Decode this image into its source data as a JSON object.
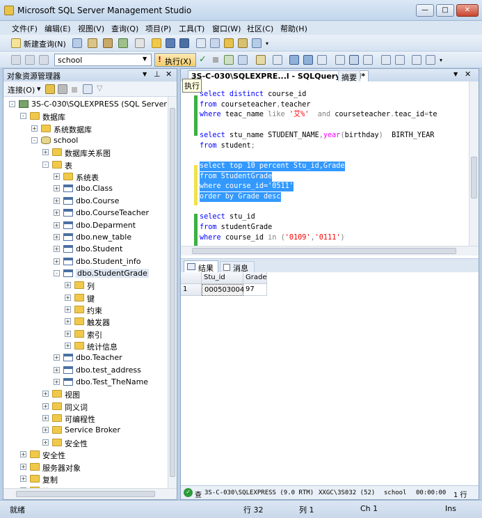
{
  "window": {
    "title": "Microsoft SQL Server Management Studio",
    "minimize": "—",
    "maximize": "□",
    "close": "✕"
  },
  "menu": [
    "文件(F)",
    "编辑(E)",
    "视图(V)",
    "查询(Q)",
    "项目(P)",
    "工具(T)",
    "窗口(W)",
    "社区(C)",
    "帮助(H)"
  ],
  "toolbar1": {
    "new_query": "新建查询(N)"
  },
  "toolbar2": {
    "database": "school",
    "execute": "执行(X)"
  },
  "object_explorer": {
    "title": "对象资源管理器",
    "connect": "连接(O)",
    "tree": [
      {
        "label": "3S-C-030\\SQLEXPRESS (SQL Server 9.0",
        "level": 0,
        "exp": "-",
        "icon": "server"
      },
      {
        "label": "数据库",
        "level": 1,
        "exp": "-",
        "icon": "folder"
      },
      {
        "label": "系统数据库",
        "level": 2,
        "exp": "+",
        "icon": "folder"
      },
      {
        "label": "school",
        "level": 2,
        "exp": "-",
        "icon": "db"
      },
      {
        "label": "数据库关系图",
        "level": 3,
        "exp": "+",
        "icon": "folder"
      },
      {
        "label": "表",
        "level": 3,
        "exp": "-",
        "icon": "folder"
      },
      {
        "label": "系统表",
        "level": 4,
        "exp": "+",
        "icon": "folder"
      },
      {
        "label": "dbo.Class",
        "level": 4,
        "exp": "+",
        "icon": "table"
      },
      {
        "label": "dbo.Course",
        "level": 4,
        "exp": "+",
        "icon": "table"
      },
      {
        "label": "dbo.CourseTeacher",
        "level": 4,
        "exp": "+",
        "icon": "table"
      },
      {
        "label": "dbo.Deparment",
        "level": 4,
        "exp": "+",
        "icon": "table"
      },
      {
        "label": "dbo.new_table",
        "level": 4,
        "exp": "+",
        "icon": "table"
      },
      {
        "label": "dbo.Student",
        "level": 4,
        "exp": "+",
        "icon": "table"
      },
      {
        "label": "dbo.Student_info",
        "level": 4,
        "exp": "+",
        "icon": "table"
      },
      {
        "label": "dbo.StudentGrade",
        "level": 4,
        "exp": "-",
        "icon": "table",
        "selected": true
      },
      {
        "label": "列",
        "level": 5,
        "exp": "+",
        "icon": "folder"
      },
      {
        "label": "键",
        "level": 5,
        "exp": "+",
        "icon": "folder"
      },
      {
        "label": "约束",
        "level": 5,
        "exp": "+",
        "icon": "folder"
      },
      {
        "label": "触发器",
        "level": 5,
        "exp": "+",
        "icon": "folder"
      },
      {
        "label": "索引",
        "level": 5,
        "exp": "+",
        "icon": "folder"
      },
      {
        "label": "统计信息",
        "level": 5,
        "exp": "+",
        "icon": "folder"
      },
      {
        "label": "dbo.Teacher",
        "level": 4,
        "exp": "+",
        "icon": "table"
      },
      {
        "label": "dbo.test_address",
        "level": 4,
        "exp": "+",
        "icon": "table"
      },
      {
        "label": "dbo.Test_TheName",
        "level": 4,
        "exp": "+",
        "icon": "table"
      },
      {
        "label": "视图",
        "level": 3,
        "exp": "+",
        "icon": "folder"
      },
      {
        "label": "同义词",
        "level": 3,
        "exp": "+",
        "icon": "folder"
      },
      {
        "label": "可编程性",
        "level": 3,
        "exp": "+",
        "icon": "folder"
      },
      {
        "label": "Service Broker",
        "level": 3,
        "exp": "+",
        "icon": "folder"
      },
      {
        "label": "安全性",
        "level": 3,
        "exp": "+",
        "icon": "folder"
      },
      {
        "label": "安全性",
        "level": 1,
        "exp": "+",
        "icon": "folder"
      },
      {
        "label": "服务器对象",
        "level": 1,
        "exp": "+",
        "icon": "folder"
      },
      {
        "label": "复制",
        "level": 1,
        "exp": "+",
        "icon": "folder"
      },
      {
        "label": "管理",
        "level": 1,
        "exp": "+",
        "icon": "folder"
      }
    ]
  },
  "editor": {
    "tab_active": "3S-C-030\\SQLEXPRE...l - SQLQuery1.sql*",
    "tab_summary": "摘要",
    "tooltip": "执行",
    "code": [
      {
        "segs": [
          [
            "kw",
            "select distinct "
          ],
          [
            "",
            "course_id"
          ]
        ]
      },
      {
        "segs": [
          [
            "kw",
            "from "
          ],
          [
            "",
            "courseteacher"
          ],
          [
            "op",
            ","
          ],
          [
            "",
            "teacher"
          ]
        ]
      },
      {
        "segs": [
          [
            "kw",
            "where "
          ],
          [
            "",
            "teac_name "
          ],
          [
            "op",
            "like "
          ],
          [
            "str",
            "'艾%'"
          ],
          [
            "",
            "  "
          ],
          [
            "op",
            "and "
          ],
          [
            "",
            "courseteacher"
          ],
          [
            "op",
            "."
          ],
          [
            "",
            "teac_id"
          ],
          [
            "op",
            "="
          ],
          [
            "",
            "te"
          ]
        ]
      },
      {
        "segs": []
      },
      {
        "segs": [
          [
            "kw",
            "select "
          ],
          [
            "",
            "stu_name STUDENT_NAME"
          ],
          [
            "op",
            ","
          ],
          [
            "fn",
            "year"
          ],
          [
            "op",
            "("
          ],
          [
            "",
            "birthday"
          ],
          [
            "op",
            ")"
          ],
          [
            "",
            "  BIRTH_YEAR"
          ]
        ]
      },
      {
        "segs": [
          [
            "kw",
            "from "
          ],
          [
            "",
            "student"
          ],
          [
            "op",
            ";"
          ]
        ]
      },
      {
        "segs": []
      },
      {
        "hl": true,
        "segs": [
          [
            "kw",
            "select top 10 percent Stu_id,Grade"
          ]
        ]
      },
      {
        "hl": true,
        "segs": [
          [
            "kw",
            "from StudentGrade"
          ]
        ]
      },
      {
        "hl": true,
        "segs": [
          [
            "kw",
            "where course_id='0511'"
          ]
        ]
      },
      {
        "hl": true,
        "segs": [
          [
            "kw",
            "order by Grade desc"
          ]
        ]
      },
      {
        "segs": []
      },
      {
        "segs": [
          [
            "kw",
            "select "
          ],
          [
            "",
            "stu_id"
          ]
        ]
      },
      {
        "segs": [
          [
            "kw",
            "from "
          ],
          [
            "",
            "studentGrade"
          ]
        ]
      },
      {
        "segs": [
          [
            "kw",
            "where "
          ],
          [
            "",
            "course_id "
          ],
          [
            "op",
            "in "
          ],
          [
            "op",
            "("
          ],
          [
            "str",
            "'0109'"
          ],
          [
            "op",
            ","
          ],
          [
            "str",
            "'0111'"
          ],
          [
            "op",
            ")"
          ]
        ]
      }
    ]
  },
  "results": {
    "tab_results": "结果",
    "tab_messages": "消息",
    "columns": [
      "Stu_id",
      "Grade"
    ],
    "rows": [
      [
        "1",
        "000503004",
        "97"
      ]
    ]
  },
  "query_status": {
    "server": "3S-C-030\\SQLEXPRESS (9.0 RTM)",
    "user": "XXGC\\3S032 (52)",
    "db": "school",
    "time": "00:00:00",
    "rows": "1 行"
  },
  "statusbar": {
    "state": "就绪",
    "line": "行 32",
    "col": "列 1",
    "ch": "Ch 1",
    "mode": "Ins"
  }
}
